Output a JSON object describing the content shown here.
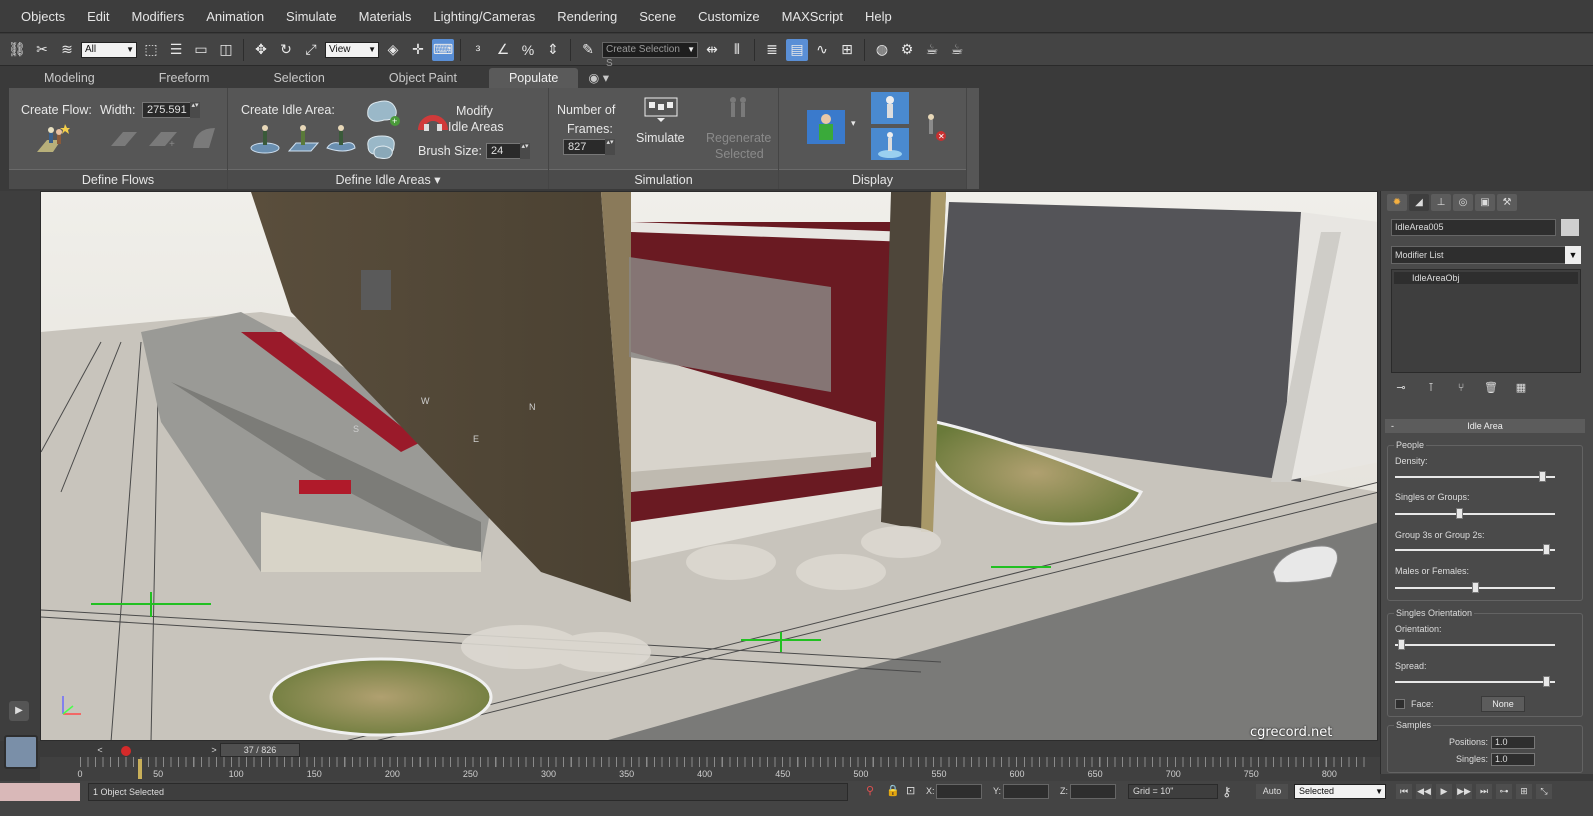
{
  "menu": [
    "Objects",
    "Edit",
    "Modifiers",
    "Animation",
    "Simulate",
    "Materials",
    "Lighting/Cameras",
    "Rendering",
    "Scene",
    "Customize",
    "MAXScript",
    "Help"
  ],
  "toolbar": {
    "filter_value": "All",
    "view_value": "View",
    "selection_set_value": "Create Selection S"
  },
  "ribbon_tabs": [
    "Modeling",
    "Freeform",
    "Selection",
    "Object Paint",
    "Populate"
  ],
  "ribbon_active_tab": "Populate",
  "ribbon": {
    "define_flows": {
      "create_flow": "Create Flow:",
      "width_label": "Width:",
      "width_value": "275.591",
      "footer": "Define Flows"
    },
    "define_idle_areas": {
      "create_idle_area": "Create Idle Area:",
      "modify_idle_areas_1": "Modify",
      "modify_idle_areas_2": "Idle Areas",
      "brush_size_label": "Brush Size:",
      "brush_size_value": "24",
      "footer": "Define Idle Areas"
    },
    "simulation": {
      "frames_label_1": "Number of",
      "frames_label_2": "Frames:",
      "frames_value": "827",
      "simulate": "Simulate",
      "regenerate_1": "Regenerate",
      "regenerate_2": "Selected",
      "footer": "Simulation"
    },
    "display": {
      "footer": "Display"
    }
  },
  "viewport": {
    "watermark": "cgrecord.net",
    "labels": [
      "W",
      "N",
      "S",
      "E"
    ]
  },
  "command_panel": {
    "object_name": "IdleArea005",
    "modifier_list": "Modifier List",
    "stack_item": "IdleAreaObj",
    "rollout_title": "Idle Area",
    "people": {
      "title": "People",
      "density": "Density:",
      "density_value": 0.94,
      "singles_or_groups": "Singles or Groups:",
      "singles_value": 0.4,
      "group3s_or_group2s": "Group 3s or Group 2s:",
      "group_value": 0.97,
      "males_or_females": "Males or Females:",
      "males_value": 0.5
    },
    "singles_orientation": {
      "title": "Singles Orientation",
      "orientation": "Orientation:",
      "orientation_value": 0.02,
      "spread": "Spread:",
      "spread_value": 0.97,
      "face_label": "Face:",
      "face_button": "None"
    },
    "samples": {
      "title": "Samples",
      "positions_label": "Positions:",
      "positions_value": "1.0",
      "singles_label": "Singles:",
      "singles_value": "1.0"
    }
  },
  "timeline": {
    "slider_text": "37 / 826",
    "current_frame": 37,
    "total_frames": 826,
    "ticks": [
      "0",
      "50",
      "100",
      "150",
      "200",
      "250",
      "300",
      "350",
      "400",
      "450",
      "500",
      "550",
      "600",
      "650",
      "700",
      "750",
      "800"
    ]
  },
  "status": {
    "selection_text": "1 Object Selected",
    "x_label": "X:",
    "y_label": "Y:",
    "z_label": "Z:",
    "grid_text": "Grid = 10\"",
    "auto": "Auto",
    "selected_dropdown": "Selected"
  }
}
